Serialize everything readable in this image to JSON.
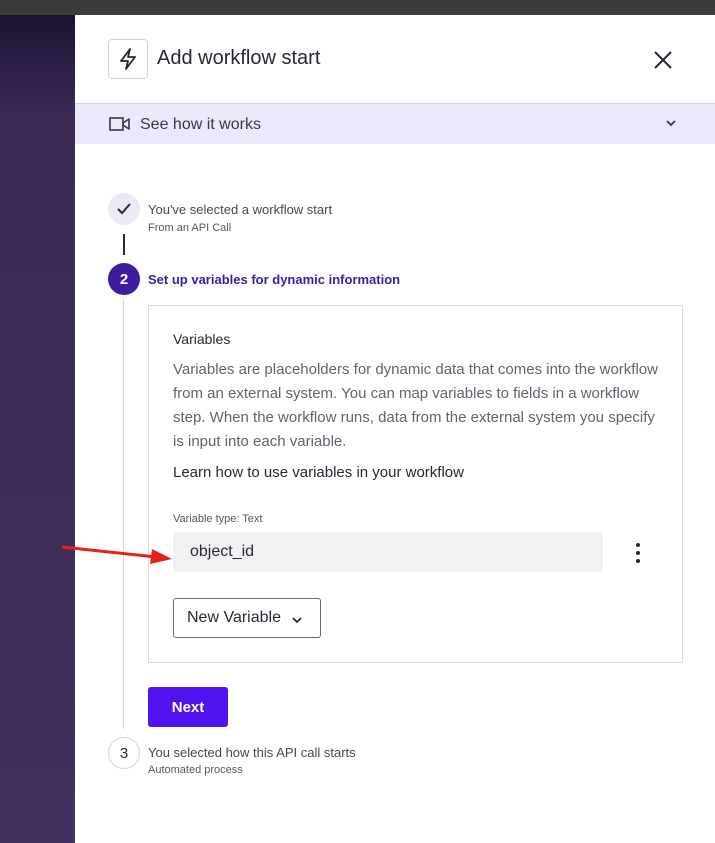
{
  "dialog": {
    "title": "Add workflow start",
    "see_how": "See how it works"
  },
  "steps": [
    {
      "number": "1",
      "title": "You've selected a workflow start",
      "subtitle": "From an API Call",
      "state": "done"
    },
    {
      "number": "2",
      "title": "Set up variables for dynamic information",
      "state": "active"
    },
    {
      "number": "3",
      "title": "You selected how this API call starts",
      "subtitle": "Automated process",
      "state": "pending"
    }
  ],
  "variables_card": {
    "heading": "Variables",
    "description": "Variables are placeholders for dynamic data that comes into the workflow from an external system. You can map variables to fields in a workflow step. When the workflow runs, data from the external system you specify is input into each variable.",
    "learn_link": "Learn how to use variables in your workflow",
    "variable_type_label": "Variable type: Text",
    "variable_value": "object_id",
    "new_variable_label": "New Variable"
  },
  "next_label": "Next",
  "icons": [
    "lightning-icon",
    "close-icon",
    "video-camera-icon",
    "chevron-down-icon",
    "checkmark-icon",
    "kebab-menu-icon"
  ],
  "colors": {
    "primary": "#5112f0",
    "step_active": "#3d1d9e",
    "banner_bg": "#ede7fb",
    "backdrop": "#42305e",
    "annotation_arrow": "#e8201c"
  }
}
